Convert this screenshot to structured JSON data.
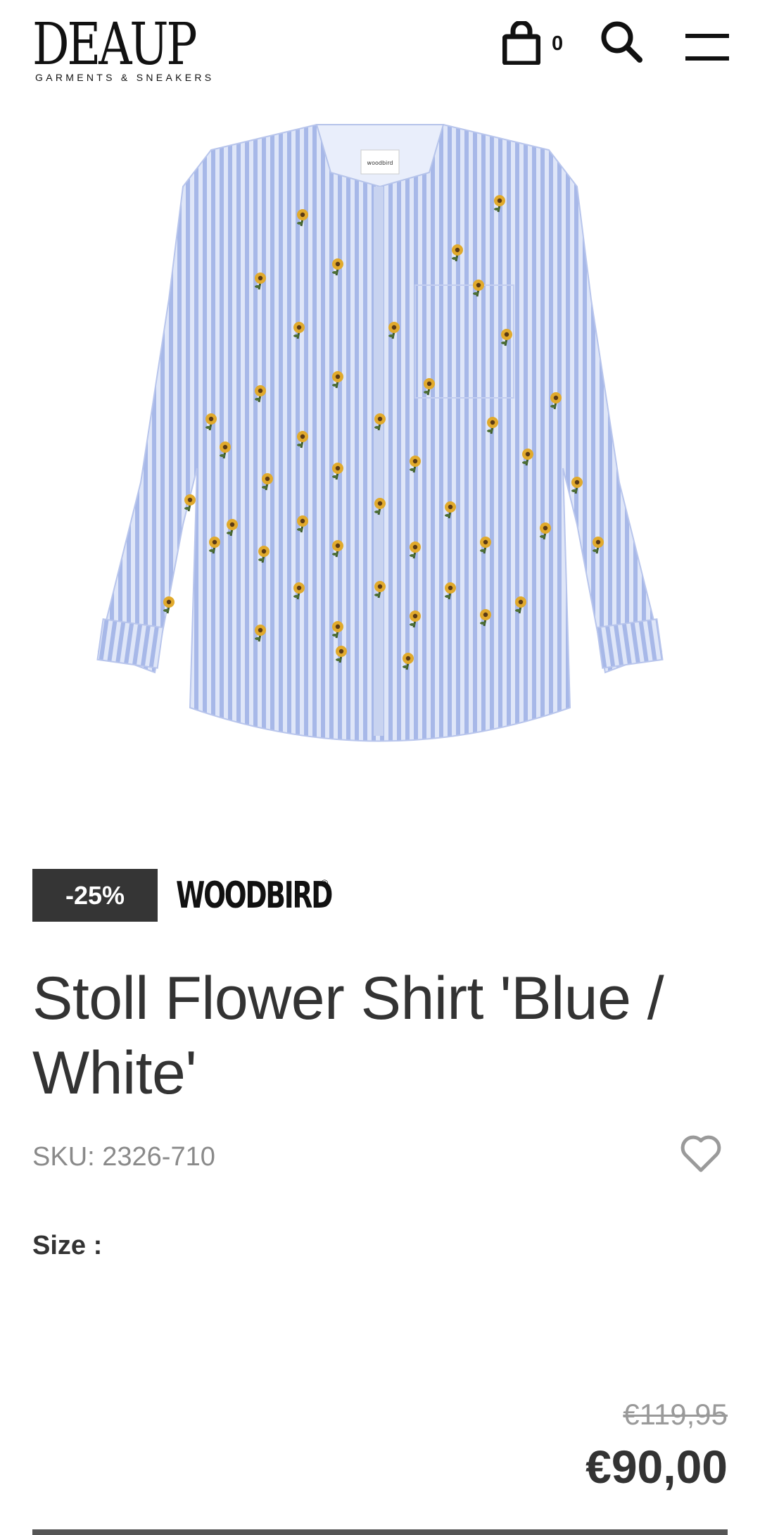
{
  "header": {
    "logo_main": "DEAUP",
    "logo_sub": "GARMENTS & SNEAKERS",
    "cart_count": "0",
    "icons": [
      "shopping-bag-icon",
      "search-icon",
      "menu-icon"
    ]
  },
  "product": {
    "image_label": "woodbird",
    "discount": "-25%",
    "brand": "WOODBIRD",
    "brand_mark": "®",
    "title": "Stoll Flower Shirt 'Blue / White'",
    "sku": "SKU: 2326-710",
    "size_label": "Size :",
    "old_price": "€119,95",
    "new_price": "€90,00"
  },
  "colors": {
    "badge_bg": "#353535",
    "text": "#333333",
    "muted": "#8a8a8a",
    "shirt_blue": "#a9b9e8",
    "flower_yellow": "#e0a92c"
  }
}
